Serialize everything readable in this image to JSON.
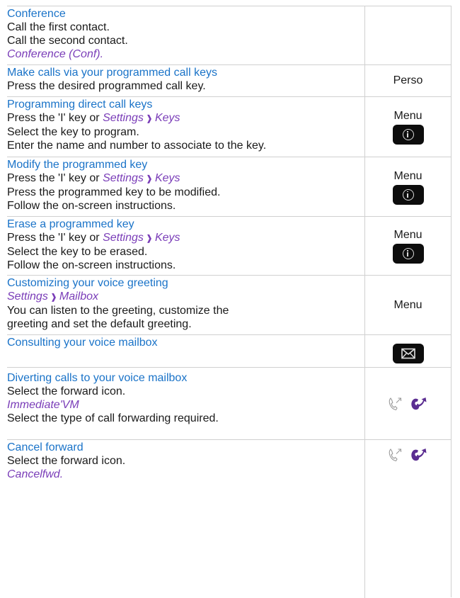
{
  "sections": [
    {
      "title": "Conference",
      "lines": [
        "Call the first contact.",
        "Call the second contact."
      ],
      "italic": "Conference (Conf)."
    },
    {
      "title": "Make calls via your programmed call keys",
      "lines": [
        "Press the desired programmed call key."
      ],
      "side_label": "Perso"
    },
    {
      "title": "Programming direct call keys",
      "press_prefix": "Press the 'I' key or",
      "path_a": "Settings",
      "path_b": "Keys",
      "lines": [
        "Select the key to program.",
        "Enter the name and number to associate to the key."
      ],
      "side_label": "Menu"
    },
    {
      "title": "Modify the programmed key",
      "press_prefix": "Press the 'I' key or",
      "path_a": "Settings",
      "path_b": "Keys",
      "lines": [
        "Press the programmed key to be modified.",
        "Follow the on-screen instructions."
      ],
      "side_label": "Menu"
    },
    {
      "title": "Erase a programmed key",
      "press_prefix": "Press the 'I' key or",
      "path_a": "Settings",
      "path_b": "Keys",
      "lines": [
        "Select the key to be erased.",
        "Follow the on-screen instructions."
      ],
      "side_label": "Menu"
    },
    {
      "title": "Customizing your voice greeting",
      "path_a": "Settings",
      "path_b": "Mailbox",
      "lines": [
        "You can listen to the greeting, customize the",
        "greeting and set the default greeting."
      ],
      "side_label": "Menu"
    },
    {
      "title": "Consulting your voice mailbox"
    },
    {
      "title": "Diverting calls to your voice mailbox",
      "lines": [
        "Select the forward icon."
      ],
      "italic": "Immediate'VM",
      "lines_after": [
        "Select the type of call forwarding required."
      ]
    },
    {
      "title": "Cancel forward",
      "lines": [
        "Select the forward icon."
      ],
      "italic": "Cancelfwd."
    }
  ],
  "path_separator": "❱",
  "icons": {
    "info_key": "info-circle-icon",
    "mail_key": "envelope-icon",
    "forward_outline": "handset-forward-outline-icon",
    "forward_filled": "handset-forward-filled-icon"
  },
  "colors": {
    "title": "#1a73c8",
    "italic": "#7a3db8",
    "key_background": "#0d0d0d",
    "border": "#d0d0d0",
    "forward_icon": "#5b2d91"
  }
}
